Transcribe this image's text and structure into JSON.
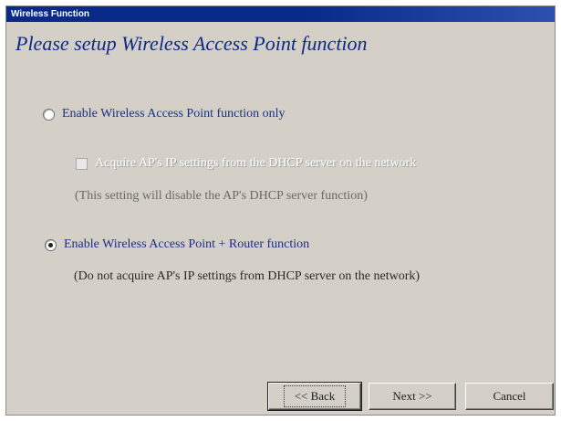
{
  "window": {
    "title": "Wireless Function"
  },
  "heading": "Please setup Wireless Access Point function",
  "options": [
    {
      "label": "Enable Wireless Access Point function only",
      "selected": false
    },
    {
      "label": "Enable Wireless Access Point + Router function",
      "selected": true
    }
  ],
  "dhcp_checkbox": {
    "label": "Acquire AP's IP settings from the DHCP server on the network",
    "checked": false,
    "enabled": false
  },
  "notes": {
    "ap_only": "(This setting will disable the AP's DHCP server function)",
    "router": "(Do not acquire AP's IP settings from DHCP server on the network)"
  },
  "buttons": {
    "back": "<< Back",
    "next": "Next >>",
    "cancel": "Cancel"
  }
}
